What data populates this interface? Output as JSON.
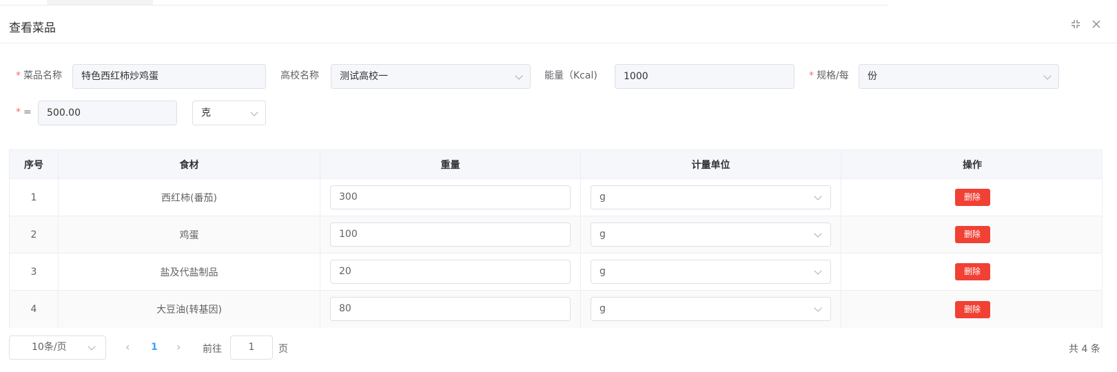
{
  "dialog": {
    "title": "查看菜品",
    "minimize_icon": "compress-icon",
    "close_icon": "close-icon"
  },
  "form": {
    "dish_name": {
      "label": "菜品名称",
      "required": "*",
      "value": "特色西红柿炒鸡蛋"
    },
    "school": {
      "label": "高校名称",
      "value": "测试高校一"
    },
    "energy": {
      "label": "能量（Kcal)",
      "value": "1000"
    },
    "spec": {
      "label": "规格/每",
      "required": "*",
      "value": "份"
    },
    "equals": {
      "label": "=",
      "required": "*",
      "value": "500.00"
    },
    "unit": {
      "value": "克"
    }
  },
  "table": {
    "headers": [
      "序号",
      "食材",
      "重量",
      "计量单位",
      "操作"
    ],
    "delete_label": "删除",
    "rows": [
      {
        "index": "1",
        "ingredient": "西红柿(番茄)",
        "weight": "300",
        "unit": "g"
      },
      {
        "index": "2",
        "ingredient": "鸡蛋",
        "weight": "100",
        "unit": "g"
      },
      {
        "index": "3",
        "ingredient": "盐及代盐制品",
        "weight": "20",
        "unit": "g"
      },
      {
        "index": "4",
        "ingredient": "大豆油(转基因)",
        "weight": "80",
        "unit": "g"
      }
    ]
  },
  "pagination": {
    "page_size": "10条/页",
    "current_page": "1",
    "goto_label": "前往",
    "goto_value": "1",
    "page_suffix": "页",
    "total": "共 4 条"
  }
}
